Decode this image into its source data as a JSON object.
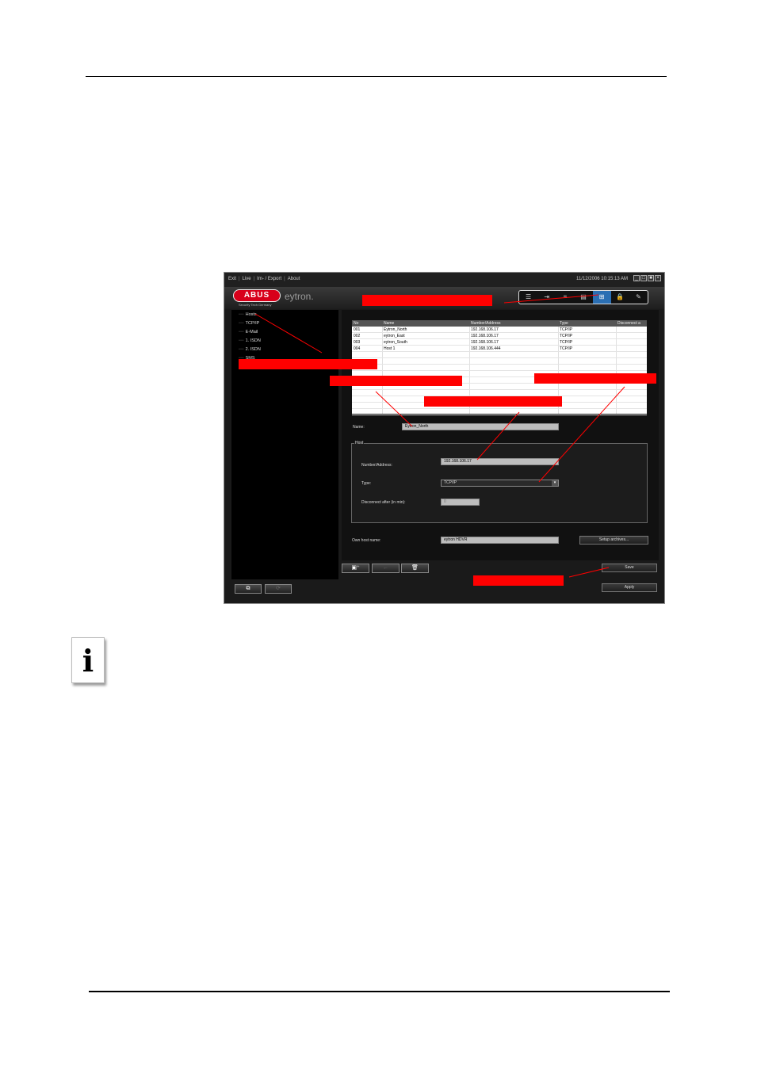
{
  "menu": {
    "items": [
      "Exit",
      "Live",
      "Im- / Export",
      "About"
    ],
    "clock": "11/12/2006 10:15:13 AM"
  },
  "header": {
    "logo": "ABUS",
    "tagline": "Security Tech Germany",
    "brand": "eytron."
  },
  "toolbar": {
    "icons": [
      "camera-list-icon",
      "export-icon",
      "settings-icon",
      "event-icon",
      "network-icon",
      "lock-icon",
      "tools-icon"
    ],
    "glyphs": [
      "☰",
      "⇥",
      "≡",
      "▤",
      "⊞",
      "🔒",
      "✎"
    ],
    "active_index": 4
  },
  "tree": {
    "items": [
      "Hosts",
      "TCP/IP",
      "E-Mail",
      "1. ISDN",
      "2. ISDN",
      "SMS"
    ],
    "selected": "Hosts"
  },
  "grid": {
    "columns": [
      "No",
      "Name",
      "Number/Address",
      "Type",
      "Disconnect a"
    ],
    "rows": [
      [
        "001",
        "Eytron_North",
        "192.168.106.17",
        "TCP/IP"
      ],
      [
        "002",
        "eytron_East",
        "192.168.106.17",
        "TCP/IP"
      ],
      [
        "003",
        "eytron_South",
        "192.168.106.17",
        "TCP/IP"
      ],
      [
        "004",
        "Host 1",
        "192.168.106.444",
        "TCP/IP"
      ]
    ]
  },
  "form": {
    "name_label": "Name:",
    "name_value": "Eytron_North",
    "group_title": "Host",
    "number_label": "Number/Address:",
    "number_value": "192.168.106.17",
    "type_label": "Type:",
    "type_value": "TCP/IP",
    "disconnect_label": "Disconnect after (in min):",
    "disconnect_value": "0",
    "own_host_label": "Own host name:",
    "own_host_value": "eytron HDVR",
    "setup_archives": "Setup archives..."
  },
  "buttons": {
    "save": "Save",
    "apply": "Apply"
  },
  "colors": {
    "callout": "#ff0000",
    "accent": "#2b6fb3",
    "logo": "#d8001a"
  }
}
